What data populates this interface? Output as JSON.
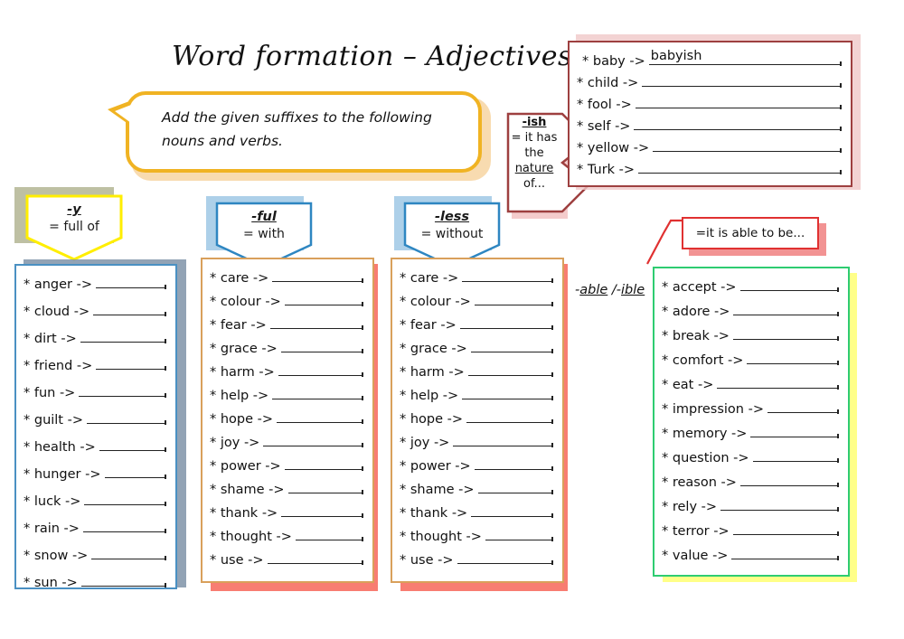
{
  "page": {
    "title": "Word formation – Adjectives",
    "instruction": "Add the given suffixes to the following nouns and verbs."
  },
  "colors": {
    "title_text": "#111111",
    "bubble_border": "#f0b323",
    "bubble_shadow": "#f6cf96",
    "y_border": "#ffee00",
    "y_shadow": "#a8ab84",
    "ful_border": "#2e86c1",
    "ful_shadow": "#a9cde8",
    "less_border": "#2e86c1",
    "less_shadow": "#a9cde8",
    "y_list_border": "#4a90c2",
    "y_list_shadow": "#7f93a8",
    "ful_list_border": "#d9a05b",
    "ful_list_shadow": "#f8766a",
    "less_list_border": "#d9a05b",
    "less_list_shadow": "#f8766a",
    "ish_border": "#9e4040",
    "ish_shadow": "#f0c8c8",
    "able_border": "#e03131",
    "able_shadow": "#f08080",
    "able_list_border": "#2ecc71",
    "able_list_shadow": "#ffff88",
    "answer_line": "#222222"
  },
  "sections": {
    "y": {
      "suffix": "-y",
      "meaning": "= full of",
      "items": [
        {
          "word": "* anger ->",
          "answer": ""
        },
        {
          "word": "* cloud ->",
          "answer": ""
        },
        {
          "word": "* dirt ->",
          "answer": ""
        },
        {
          "word": "* friend ->",
          "answer": ""
        },
        {
          "word": "* fun ->",
          "answer": ""
        },
        {
          "word": "* guilt ->",
          "answer": ""
        },
        {
          "word": "* health ->",
          "answer": ""
        },
        {
          "word": "* hunger ->",
          "answer": ""
        },
        {
          "word": "* luck ->",
          "answer": ""
        },
        {
          "word": "* rain ->",
          "answer": ""
        },
        {
          "word": "* snow ->",
          "answer": ""
        },
        {
          "word": "* sun ->",
          "answer": ""
        }
      ]
    },
    "ful": {
      "suffix": "-ful",
      "meaning": "= with",
      "items": [
        {
          "word": "* care ->",
          "answer": ""
        },
        {
          "word": "* colour ->",
          "answer": ""
        },
        {
          "word": "* fear ->",
          "answer": ""
        },
        {
          "word": "* grace ->",
          "answer": ""
        },
        {
          "word": "* harm ->",
          "answer": ""
        },
        {
          "word": "* help ->",
          "answer": ""
        },
        {
          "word": "* hope ->",
          "answer": ""
        },
        {
          "word": "* joy ->",
          "answer": ""
        },
        {
          "word": "* power ->",
          "answer": ""
        },
        {
          "word": "* shame ->",
          "answer": ""
        },
        {
          "word": "* thank ->",
          "answer": ""
        },
        {
          "word": "* thought ->",
          "answer": ""
        },
        {
          "word": "* use ->",
          "answer": ""
        }
      ]
    },
    "less": {
      "suffix": "-less",
      "meaning": "= without",
      "items": [
        {
          "word": "* care ->",
          "answer": ""
        },
        {
          "word": "* colour ->",
          "answer": ""
        },
        {
          "word": "* fear ->",
          "answer": ""
        },
        {
          "word": "* grace ->",
          "answer": ""
        },
        {
          "word": "* harm ->",
          "answer": ""
        },
        {
          "word": "* help ->",
          "answer": ""
        },
        {
          "word": "* hope ->",
          "answer": ""
        },
        {
          "word": "* joy ->",
          "answer": ""
        },
        {
          "word": "* power ->",
          "answer": ""
        },
        {
          "word": "* shame ->",
          "answer": ""
        },
        {
          "word": "* thank ->",
          "answer": ""
        },
        {
          "word": "* thought ->",
          "answer": ""
        },
        {
          "word": "* use ->",
          "answer": ""
        }
      ]
    },
    "ish": {
      "suffix": "-ish",
      "meaning_line1": "= it has",
      "meaning_line2": "the",
      "meaning_line3": "nature",
      "meaning_line4": "of...",
      "items": [
        {
          "word": "* baby ->",
          "answer": "babyish"
        },
        {
          "word": "* child ->",
          "answer": ""
        },
        {
          "word": "* fool ->",
          "answer": ""
        },
        {
          "word": "* self ->",
          "answer": ""
        },
        {
          "word": "* yellow ->",
          "answer": ""
        },
        {
          "word": "* Turk ->",
          "answer": ""
        }
      ]
    },
    "able": {
      "label": "-able /-ible",
      "label_part1": "-",
      "label_part2": "able",
      "label_part3": " /-",
      "label_part4": "ible",
      "meaning": "=it is able to be...",
      "items": [
        {
          "word": "* accept ->",
          "answer": ""
        },
        {
          "word": "* adore ->",
          "answer": ""
        },
        {
          "word": "* break ->",
          "answer": ""
        },
        {
          "word": "* comfort ->",
          "answer": ""
        },
        {
          "word": "* eat ->",
          "answer": ""
        },
        {
          "word": "* impression ->",
          "answer": ""
        },
        {
          "word": "* memory ->",
          "answer": ""
        },
        {
          "word": "* question ->",
          "answer": ""
        },
        {
          "word": "* reason ->",
          "answer": ""
        },
        {
          "word": "* rely ->",
          "answer": ""
        },
        {
          "word": "* terror ->",
          "answer": ""
        },
        {
          "word": "* value ->",
          "answer": ""
        }
      ]
    }
  }
}
